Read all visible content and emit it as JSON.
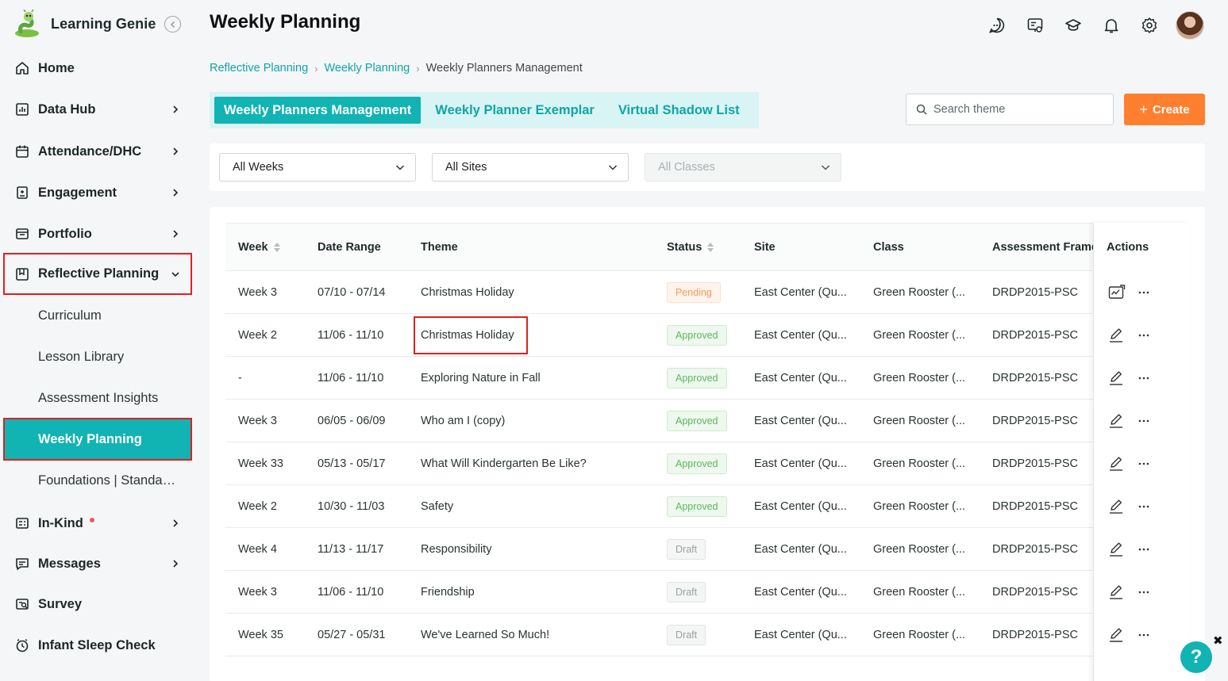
{
  "app": {
    "brand_name": "Learning Genie"
  },
  "sidebar": {
    "items": [
      {
        "label": "Home",
        "icon": "home-icon"
      },
      {
        "label": "Data Hub",
        "icon": "data-hub-icon"
      },
      {
        "label": "Attendance/DHC",
        "icon": "calendar-icon"
      },
      {
        "label": "Engagement",
        "icon": "engagement-icon"
      },
      {
        "label": "Portfolio",
        "icon": "portfolio-icon"
      },
      {
        "label": "Reflective Planning",
        "icon": "reflective-planning-icon"
      },
      {
        "label": "In-Kind",
        "icon": "in-kind-icon"
      },
      {
        "label": "Messages",
        "icon": "messages-icon"
      },
      {
        "label": "Survey",
        "icon": "survey-icon"
      },
      {
        "label": "Infant Sleep Check",
        "icon": "clock-icon"
      }
    ],
    "subitems": [
      {
        "label": "Curriculum"
      },
      {
        "label": "Lesson Library"
      },
      {
        "label": "Assessment Insights"
      },
      {
        "label": "Weekly Planning",
        "active": true
      },
      {
        "label": "Foundations | Standards"
      }
    ]
  },
  "header": {
    "title": "Weekly Planning"
  },
  "breadcrumb": [
    "Reflective Planning",
    "Weekly Planning",
    "Weekly Planners Management"
  ],
  "tabs": [
    "Weekly Planners Management",
    "Weekly Planner Exemplar",
    "Virtual Shadow List"
  ],
  "search": {
    "placeholder": "Search theme"
  },
  "create_button": {
    "label": "Create"
  },
  "filters": {
    "weeks": "All Weeks",
    "sites": "All Sites",
    "classes": "All Classes"
  },
  "table": {
    "headers": [
      "Week",
      "Date Range",
      "Theme",
      "Status",
      "Site",
      "Class",
      "Assessment Frame",
      "Actions"
    ],
    "rows": [
      {
        "week": "Week 3",
        "date": "07/10 - 07/14",
        "theme": "Christmas Holiday",
        "status": "Pending",
        "status_kind": "pending",
        "site": "East Center (Qu...",
        "class": "Green Rooster (...",
        "framework": "DRDP2015-PSC",
        "action": "review"
      },
      {
        "week": "Week 2",
        "date": "11/06 - 11/10",
        "theme": "Christmas Holiday",
        "status": "Approved",
        "status_kind": "approved",
        "site": "East Center (Qu...",
        "class": "Green Rooster (...",
        "framework": "DRDP2015-PSC",
        "action": "edit"
      },
      {
        "week": "-",
        "date": "11/06 - 11/10",
        "theme": "Exploring Nature in Fall",
        "status": "Approved",
        "status_kind": "approved",
        "site": "East Center (Qu...",
        "class": "Green Rooster (...",
        "framework": "DRDP2015-PSC",
        "action": "edit"
      },
      {
        "week": "Week 3",
        "date": "06/05 - 06/09",
        "theme": "Who am I (copy)",
        "status": "Approved",
        "status_kind": "approved",
        "site": "East Center (Qu...",
        "class": "Green Rooster (...",
        "framework": "DRDP2015-PSC",
        "action": "edit"
      },
      {
        "week": "Week 33",
        "date": "05/13 - 05/17",
        "theme": "What Will Kindergarten Be Like?",
        "status": "Approved",
        "status_kind": "approved",
        "site": "East Center (Qu...",
        "class": "Green Rooster (...",
        "framework": "DRDP2015-PSC",
        "action": "edit"
      },
      {
        "week": "Week 2",
        "date": "10/30 - 11/03",
        "theme": "Safety",
        "status": "Approved",
        "status_kind": "approved",
        "site": "East Center (Qu...",
        "class": "Green Rooster (...",
        "framework": "DRDP2015-PSC",
        "action": "edit"
      },
      {
        "week": "Week 4",
        "date": "11/13 - 11/17",
        "theme": "Responsibility",
        "status": "Draft",
        "status_kind": "draft",
        "site": "East Center (Qu...",
        "class": "Green Rooster (...",
        "framework": "DRDP2015-PSC",
        "action": "edit"
      },
      {
        "week": "Week 3",
        "date": "11/06 - 11/10",
        "theme": "Friendship",
        "status": "Draft",
        "status_kind": "draft",
        "site": "East Center (Qu...",
        "class": "Green Rooster (...",
        "framework": "DRDP2015-PSC",
        "action": "edit"
      },
      {
        "week": "Week 35",
        "date": "05/27 - 05/31",
        "theme": "We've Learned So Much!",
        "status": "Draft",
        "status_kind": "draft",
        "site": "East Center (Qu...",
        "class": "Green Rooster (...",
        "framework": "DRDP2015-PSC",
        "action": "edit"
      }
    ]
  },
  "help": {
    "label": "?",
    "close": "✖"
  },
  "colors": {
    "accent": "#11b3b3",
    "create": "#ff7f2e",
    "highlight": "#e02020"
  }
}
